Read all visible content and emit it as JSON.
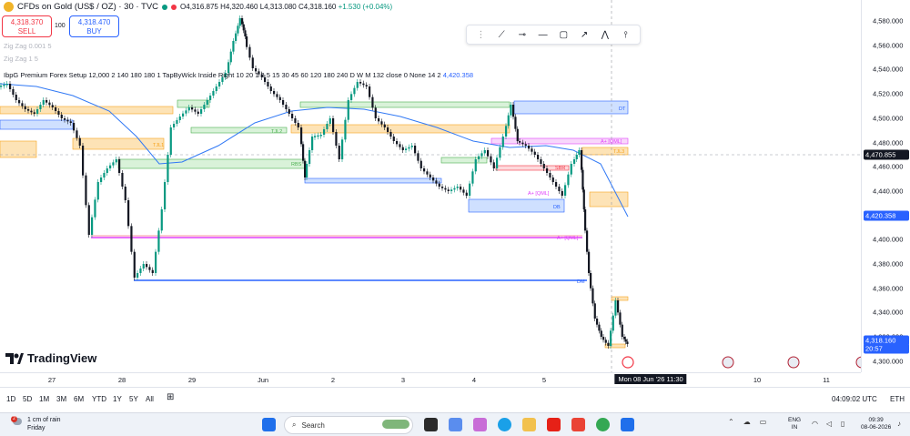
{
  "header": {
    "symbol": "CFDs on Gold (US$ / OZ) · 30 · TVC",
    "open": "O4,316.875",
    "high": "H4,320.460",
    "low": "L4,313.080",
    "close": "C4,318.160",
    "change": "+1.530 (+0.04%)"
  },
  "trade": {
    "sell_price": "4,318.370",
    "sell_label": "SELL",
    "lot": "100",
    "buy_price": "4,318.470",
    "buy_label": "BUY"
  },
  "indicators": [
    "Zig Zag 0.001 5",
    "Zig Zag 1 5",
    "IbpG Premium Forex Setup 12,000 2 140 180 180 1 TapByWick Inside Right 10 20 1 3 5 15 30 45 60 120 180 240 D W M 132 close 0 None 14 2",
    "4,420.358"
  ],
  "price_axis": {
    "ticks": [
      "4,580.000",
      "4,560.000",
      "4,540.000",
      "4,520.000",
      "4,500.000",
      "4,480.000",
      "4,460.000",
      "4,440.000",
      "4,420.000",
      "4,400.000",
      "4,380.000",
      "4,360.000",
      "4,340.000",
      "4,320.000",
      "4,300.000"
    ],
    "crosshair_price": "4,470.855",
    "indicator_price": "4,420.358",
    "last_price": "4,318.160",
    "countdown": "20:57"
  },
  "time_axis": {
    "labels": [
      "27",
      "28",
      "29",
      "Jun",
      "2",
      "3",
      "4",
      "5",
      "10",
      "11"
    ],
    "crosshair_label": "Mon 08 Jun '26   11:30"
  },
  "zone_labels": {
    "dt": "DT",
    "db": "DB",
    "rbs": "RBS",
    "tjl1": "TJL1",
    "tjl2": "TJL2",
    "sbr": "SBR",
    "aqml_top": "A+ [QML]",
    "aqml_mid": "A+ [QML]",
    "aqml_low": "A+ [QML]",
    "tjl_right": "TJL3",
    "dm_a": "DM"
  },
  "brand": {
    "name": "TradingView"
  },
  "drawing_toolbar": [
    "trend-line",
    "horizontal-ray",
    "horizontal-line",
    "rectangle",
    "arrow",
    "path",
    "vertical-line"
  ],
  "bottom_bar": {
    "ranges": [
      "1D",
      "5D",
      "1M",
      "3M",
      "6M",
      "YTD",
      "1Y",
      "5Y",
      "All"
    ],
    "clock": "04:09:02 UTC",
    "currency": "ETH"
  },
  "taskbar": {
    "weather_badge": "2",
    "weather_line1": "1 cm of rain",
    "weather_line2": "Friday",
    "search_placeholder": "Search",
    "lang_line1": "ENG",
    "lang_line2": "IN",
    "time": "09:39",
    "date": "08-06-2026"
  },
  "colors": {
    "up": "#089981",
    "down": "#131722",
    "blue_zone": "#2962ff",
    "orange_zone": "#f7a21b",
    "green_zone": "#4caf50",
    "pink_zone": "#e040fb",
    "red_zone": "#f23645",
    "ma_line": "#3179f5"
  }
}
